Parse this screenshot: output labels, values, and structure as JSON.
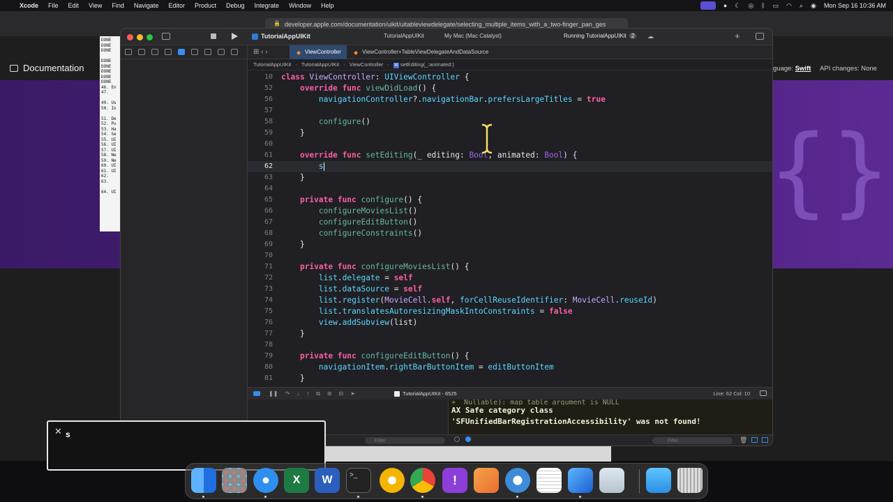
{
  "menubar": {
    "app_name": "Xcode",
    "items": [
      "File",
      "Edit",
      "View",
      "Find",
      "Navigate",
      "Editor",
      "Product",
      "Debug",
      "Integrate",
      "Window",
      "Help"
    ],
    "clock": "Mon Sep 16  10:36 AM"
  },
  "safari": {
    "url": "developer.apple.com/documentation/uikit/uitableviewdelegate/selecting_multiple_items_with_a_two-finger_pan_ges",
    "doc_title": "Documentation",
    "language_label": "guage:",
    "language_value": "Swift",
    "api_changes": "API changes: None",
    "terminal_lines": "DONE\nDONE\nDONE\n\nDONE\nDONE\nDONE\nDONE\nDONE\n46. En\n47.\n\n49. Us\n50. In\n\n51. De\n52. Pu\n53. Ha\n54. Se\n55. UI\n56. UI\n57. UI\n58. Ne\n59. Ne\n60. UI\n61. UI\n62.\n63.\n\n64. UI"
  },
  "xcode": {
    "project_name": "TutorialAppUIKit",
    "scheme": "TutorialAppUIKit",
    "destination": "My Mac (Mac Catalyst)",
    "status": "Running TutorialAppUIKit",
    "status_badge": "2",
    "tabs": [
      "ViewController",
      "ViewController+TableViewDelegateAndDataSource"
    ],
    "breadcrumbs": [
      "TutorialAppUIKit",
      "TutorialAppUIKit",
      "ViewController",
      "setEditing(_:animated:)"
    ],
    "breadcrumb_method_icon": "M",
    "code_lines": [
      {
        "n": "10",
        "parts": [
          [
            "k",
            "class "
          ],
          [
            "tb",
            "ViewController"
          ],
          [
            "p",
            ": "
          ],
          [
            "t",
            "UIViewController"
          ],
          [
            "p",
            " {"
          ]
        ]
      },
      {
        "n": "52",
        "parts": [
          [
            "p",
            "    "
          ],
          [
            "k",
            "override func "
          ],
          [
            "f",
            "viewDidLoad"
          ],
          [
            "p",
            "() {"
          ]
        ]
      },
      {
        "n": "56",
        "parts": [
          [
            "p",
            "        "
          ],
          [
            "t",
            "navigationController"
          ],
          [
            "p",
            "?."
          ],
          [
            "t",
            "navigationBar"
          ],
          [
            "p",
            "."
          ],
          [
            "t",
            "prefersLargeTitles"
          ],
          [
            "p",
            " = "
          ],
          [
            "k",
            "true"
          ]
        ]
      },
      {
        "n": "57",
        "parts": []
      },
      {
        "n": "58",
        "parts": [
          [
            "p",
            "        "
          ],
          [
            "f",
            "configure"
          ],
          [
            "p",
            "()"
          ]
        ]
      },
      {
        "n": "59",
        "parts": [
          [
            "p",
            "    }"
          ]
        ]
      },
      {
        "n": "60",
        "parts": []
      },
      {
        "n": "61",
        "parts": [
          [
            "p",
            "    "
          ],
          [
            "k",
            "override func "
          ],
          [
            "f",
            "setEditing"
          ],
          [
            "p",
            "(_ editing: "
          ],
          [
            "fp",
            "Bool"
          ],
          [
            "p",
            ", animated: "
          ],
          [
            "fp",
            "Bool"
          ],
          [
            "p",
            ") {"
          ]
        ]
      },
      {
        "n": "62",
        "parts": [
          [
            "p",
            "        "
          ],
          [
            "t",
            "s"
          ]
        ],
        "current": true
      },
      {
        "n": "63",
        "parts": [
          [
            "p",
            "    }"
          ]
        ]
      },
      {
        "n": "64",
        "parts": []
      },
      {
        "n": "65",
        "parts": [
          [
            "p",
            "    "
          ],
          [
            "k",
            "private func "
          ],
          [
            "f",
            "configure"
          ],
          [
            "p",
            "() {"
          ]
        ]
      },
      {
        "n": "66",
        "parts": [
          [
            "p",
            "        "
          ],
          [
            "f",
            "configureMoviesList"
          ],
          [
            "p",
            "()"
          ]
        ]
      },
      {
        "n": "67",
        "parts": [
          [
            "p",
            "        "
          ],
          [
            "f",
            "configureEditButton"
          ],
          [
            "p",
            "()"
          ]
        ]
      },
      {
        "n": "68",
        "parts": [
          [
            "p",
            "        "
          ],
          [
            "f",
            "configureConstraints"
          ],
          [
            "p",
            "()"
          ]
        ]
      },
      {
        "n": "69",
        "parts": [
          [
            "p",
            "    }"
          ]
        ]
      },
      {
        "n": "70",
        "parts": []
      },
      {
        "n": "71",
        "parts": [
          [
            "p",
            "    "
          ],
          [
            "k",
            "private func "
          ],
          [
            "f",
            "configureMoviesList"
          ],
          [
            "p",
            "() {"
          ]
        ]
      },
      {
        "n": "72",
        "parts": [
          [
            "p",
            "        "
          ],
          [
            "t",
            "list"
          ],
          [
            "p",
            "."
          ],
          [
            "t",
            "delegate"
          ],
          [
            "p",
            " = "
          ],
          [
            "k",
            "self"
          ]
        ]
      },
      {
        "n": "73",
        "parts": [
          [
            "p",
            "        "
          ],
          [
            "t",
            "list"
          ],
          [
            "p",
            "."
          ],
          [
            "t",
            "dataSource"
          ],
          [
            "p",
            " = "
          ],
          [
            "k",
            "self"
          ]
        ]
      },
      {
        "n": "74",
        "parts": [
          [
            "p",
            "        "
          ],
          [
            "t",
            "list"
          ],
          [
            "p",
            "."
          ],
          [
            "t",
            "register"
          ],
          [
            "p",
            "("
          ],
          [
            "tb",
            "MovieCell"
          ],
          [
            "p",
            "."
          ],
          [
            "k",
            "self"
          ],
          [
            "p",
            ", "
          ],
          [
            "t",
            "forCellReuseIdentifier"
          ],
          [
            "p",
            ": "
          ],
          [
            "tb",
            "MovieCell"
          ],
          [
            "p",
            "."
          ],
          [
            "t",
            "reuseId"
          ],
          [
            "p",
            ")"
          ]
        ]
      },
      {
        "n": "75",
        "parts": [
          [
            "p",
            "        "
          ],
          [
            "t",
            "list"
          ],
          [
            "p",
            "."
          ],
          [
            "t",
            "translatesAutoresizingMaskIntoConstraints"
          ],
          [
            "p",
            " = "
          ],
          [
            "k",
            "false"
          ]
        ]
      },
      {
        "n": "76",
        "parts": [
          [
            "p",
            "        "
          ],
          [
            "t",
            "view"
          ],
          [
            "p",
            "."
          ],
          [
            "t",
            "addSubview"
          ],
          [
            "p",
            "(list)"
          ]
        ]
      },
      {
        "n": "77",
        "parts": [
          [
            "p",
            "    }"
          ]
        ]
      },
      {
        "n": "78",
        "parts": []
      },
      {
        "n": "79",
        "parts": [
          [
            "p",
            "    "
          ],
          [
            "k",
            "private func "
          ],
          [
            "f",
            "configureEditButton"
          ],
          [
            "p",
            "() {"
          ]
        ]
      },
      {
        "n": "80",
        "parts": [
          [
            "p",
            "        "
          ],
          [
            "t",
            "navigationItem"
          ],
          [
            "p",
            "."
          ],
          [
            "t",
            "rightBarButtonItem"
          ],
          [
            "p",
            " = "
          ],
          [
            "t",
            "editButtonItem"
          ]
        ]
      },
      {
        "n": "81",
        "parts": [
          [
            "p",
            "    }"
          ]
        ]
      }
    ],
    "debug_process": "TutorialAppUIKit - 6525",
    "cursor_position": "Line: 62  Col: 10",
    "console_faint": "+ _Nullable): map table argument is NULL",
    "console_lines": [
      "AX Safe category class",
      "'SFUnifiedBarRegistrationAccessibility' was not found!"
    ],
    "filter_left_placeholder": "Filter",
    "filter_right_placeholder": "Filter"
  },
  "keystroke_overlay": {
    "key": "s"
  },
  "dock": {
    "apps": [
      "Finder",
      "Launchpad",
      "Safari",
      "Excel",
      "Word",
      "Terminal",
      "Chrome Canary",
      "Chrome",
      "Feedback",
      "Pages",
      "QuickTime",
      "TextEdit",
      "Xcode",
      "Preview",
      "Folder",
      "Trash"
    ]
  },
  "colors": {
    "accent": "#3a8cf0",
    "hero_purple": "#4a1f7c",
    "keyword": "#fc5fa3",
    "type": "#5dd8ff"
  }
}
